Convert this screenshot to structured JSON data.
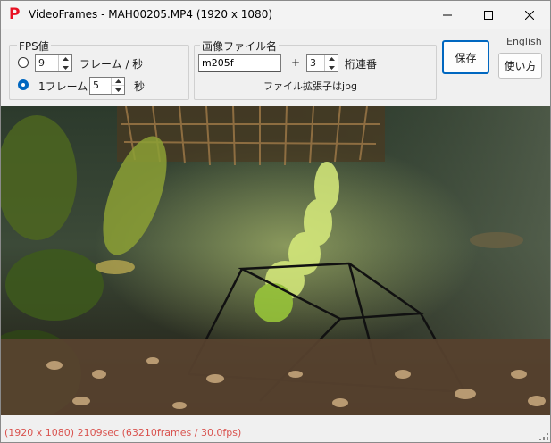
{
  "window": {
    "title": "VideoFrames - MAH00205.MP4 (1920 x 1080)",
    "icon_glyph": "P",
    "accent_color": "#e81123"
  },
  "fps_group": {
    "label": "FPS値",
    "option1": {
      "value": "9",
      "suffix": "フレーム / 秒",
      "selected": false
    },
    "option2": {
      "prefix": "1フレーム /",
      "value": "5",
      "suffix": "秒",
      "selected": true
    }
  },
  "name_group": {
    "label": "画像ファイル名",
    "filename": "m205f",
    "plus": "+",
    "digits": "3",
    "digits_label": "桁連番",
    "extension_note": "ファイル拡張子はjpg"
  },
  "buttons": {
    "save": "保存",
    "help": "使い方",
    "language": "English"
  },
  "status": {
    "text": "(1920 x 1080) 2109sec (63210frames / 30.0fps)",
    "color": "#d9534f"
  },
  "preview": {
    "description_icon": "video-frame-preview"
  }
}
